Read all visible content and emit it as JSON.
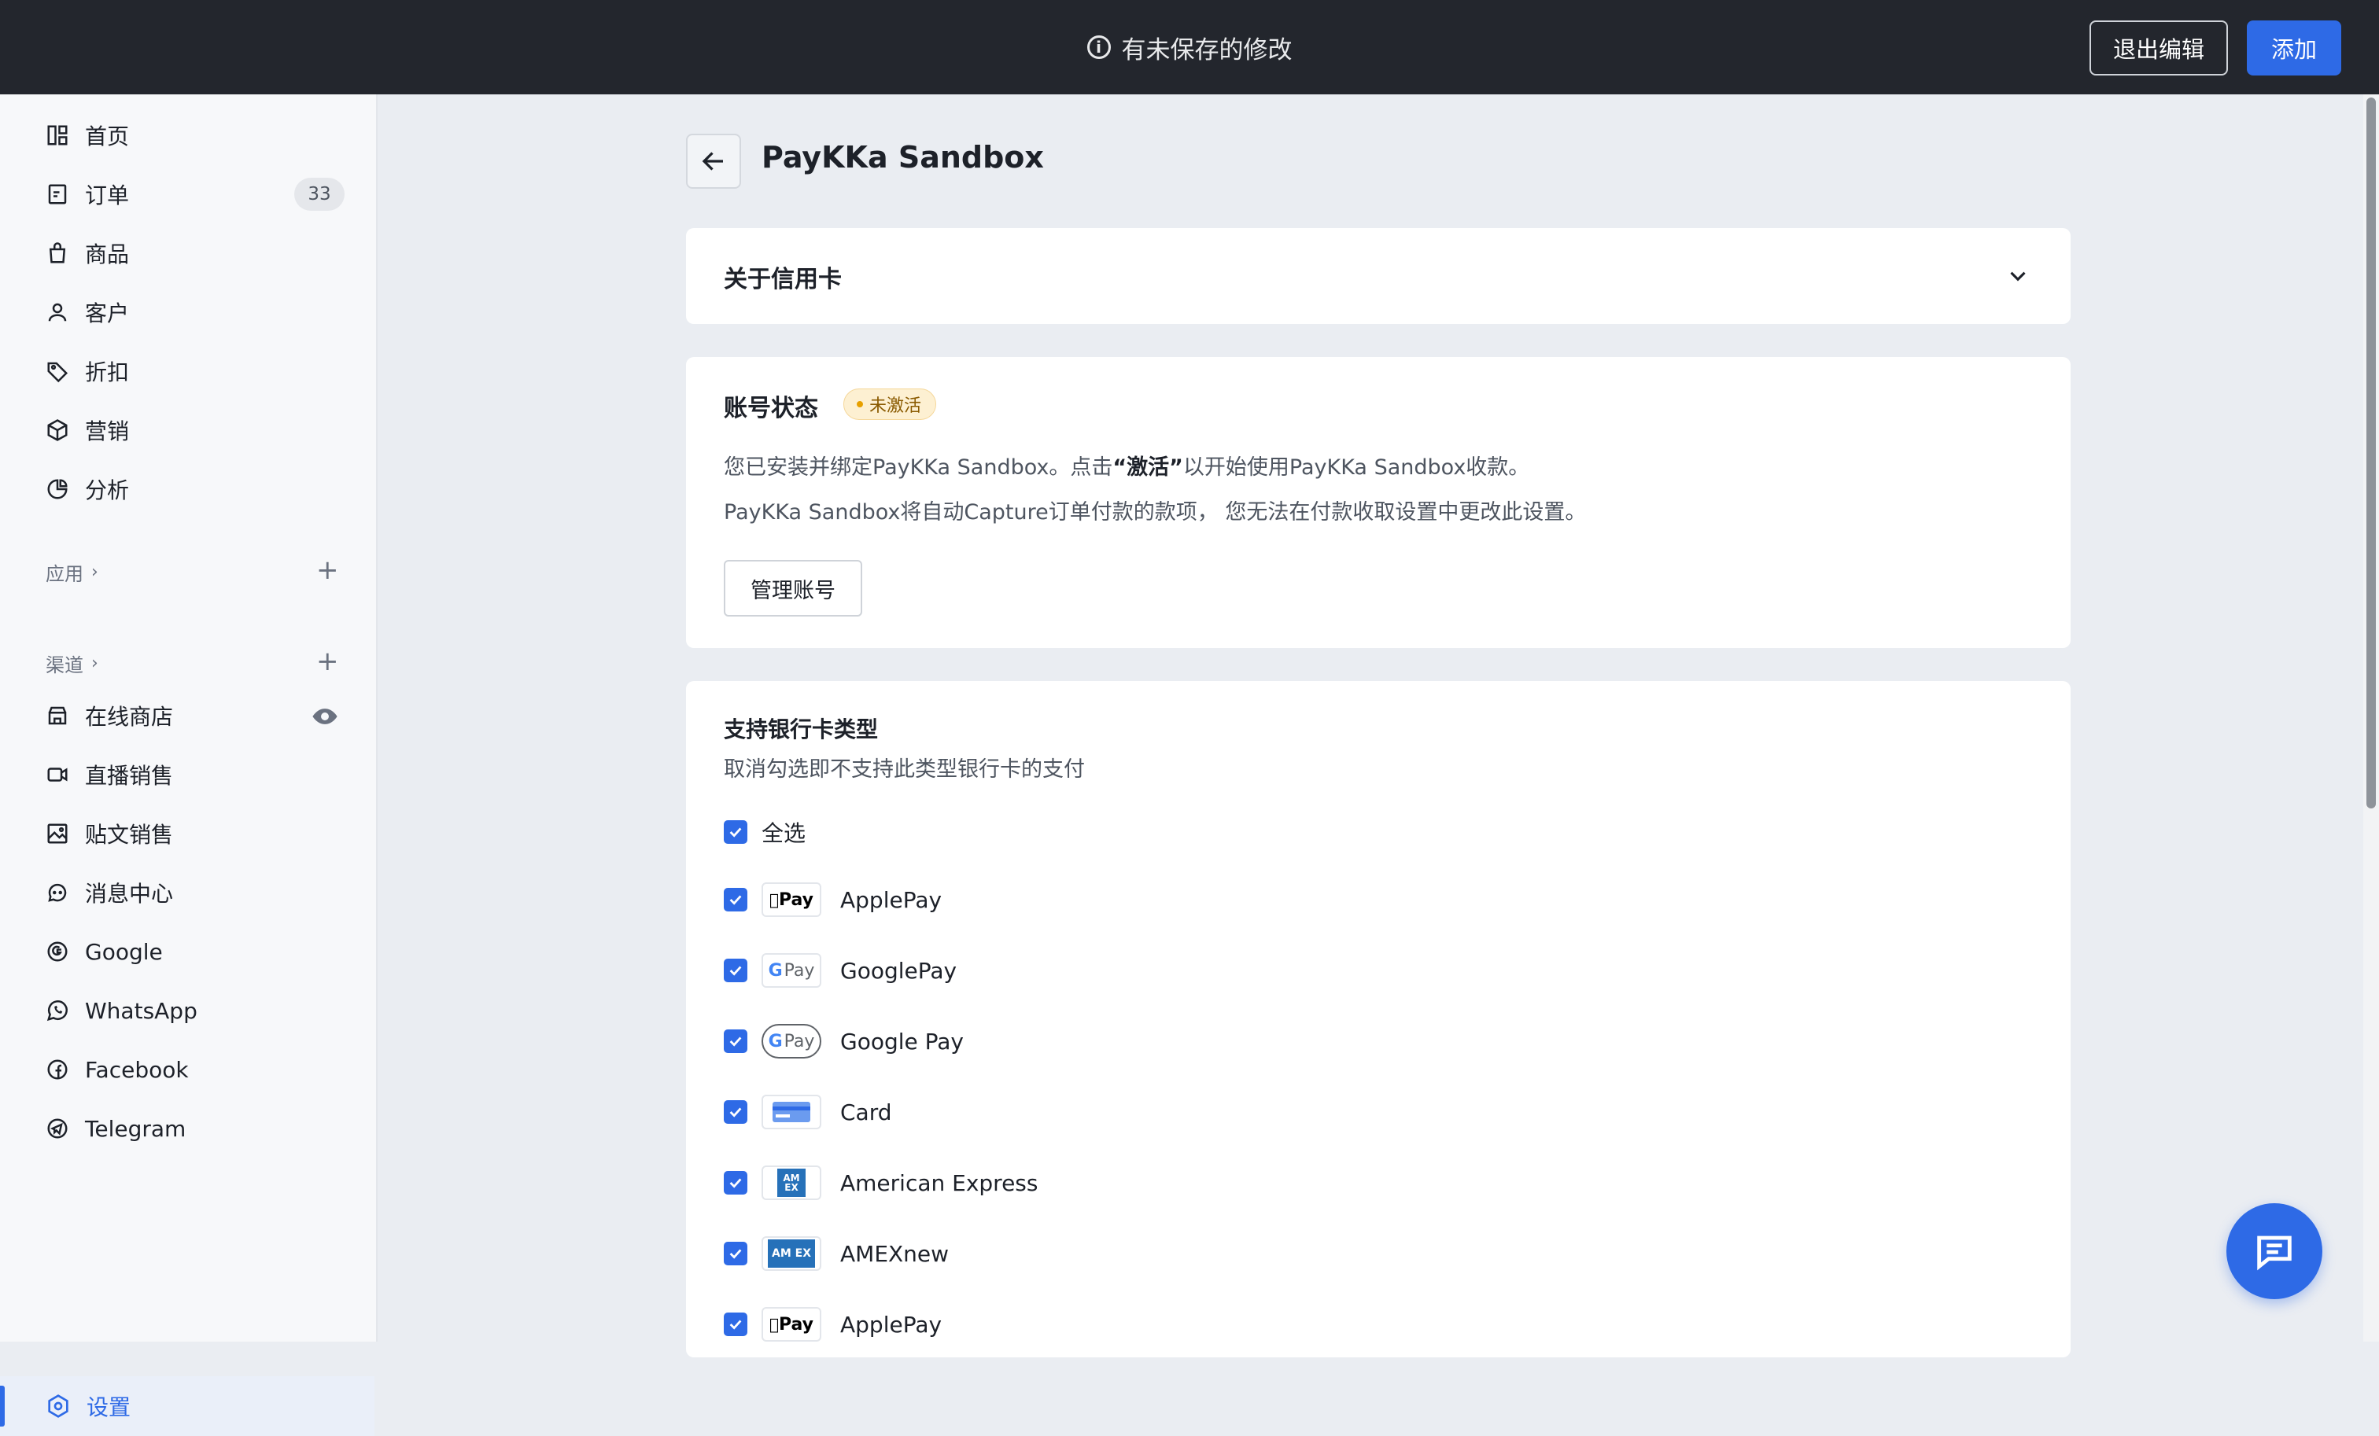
{
  "topbar": {
    "unsaved_text": "有未保存的修改",
    "exit_label": "退出编辑",
    "add_label": "添加"
  },
  "sidebar": {
    "items": [
      {
        "label": "首页",
        "icon": "dashboard-icon"
      },
      {
        "label": "订单",
        "icon": "order-icon",
        "badge": "33"
      },
      {
        "label": "商品",
        "icon": "bag-icon"
      },
      {
        "label": "客户",
        "icon": "user-icon"
      },
      {
        "label": "折扣",
        "icon": "tag-icon"
      },
      {
        "label": "营销",
        "icon": "cube-icon"
      },
      {
        "label": "分析",
        "icon": "pie-chart-icon"
      }
    ],
    "apps_title": "应用",
    "channels_title": "渠道",
    "channels": [
      {
        "label": "在线商店",
        "icon": "store-icon"
      },
      {
        "label": "直播销售",
        "icon": "video-icon"
      },
      {
        "label": "贴文销售",
        "icon": "image-icon"
      },
      {
        "label": "消息中心",
        "icon": "chat-bubble-icon"
      },
      {
        "label": "Google",
        "icon": "google-icon"
      },
      {
        "label": "WhatsApp",
        "icon": "whatsapp-icon"
      },
      {
        "label": "Facebook",
        "icon": "facebook-icon"
      },
      {
        "label": "Telegram",
        "icon": "telegram-icon"
      }
    ],
    "settings_label": "设置"
  },
  "main": {
    "title": "PayKKa Sandbox",
    "about_card": {
      "title": "关于信用卡"
    },
    "account_card": {
      "title": "账号状态",
      "status": "未激活",
      "line1_prefix": "您已安装并绑定PayKKa Sandbox。点击",
      "line1_bold": "“激活”",
      "line1_suffix": "以开始使用PayKKa Sandbox收款。",
      "line2": "PayKKa Sandbox将自动Capture订单付款的款项，  您无法在付款收取设置中更改此设置。",
      "manage_label": "管理账号"
    },
    "card_types": {
      "title": "支持银行卡类型",
      "subtitle": "取消勾选即不支持此类型银行卡的支付",
      "select_all": "全选",
      "items": [
        {
          "label": "ApplePay",
          "logo": "Pay",
          "logo_icon": "apple-pay-logo"
        },
        {
          "label": "GooglePay",
          "logo": "Pay",
          "logo_icon": "google-pay-logo"
        },
        {
          "label": "Google Pay",
          "logo": "Pay",
          "logo_icon": "google-pay-pill-logo"
        },
        {
          "label": "Card",
          "logo": "",
          "logo_icon": "card-logo"
        },
        {
          "label": "American Express",
          "logo": "AM EX",
          "logo_icon": "amex-logo"
        },
        {
          "label": "AMEXnew",
          "logo": "AM EX",
          "logo_icon": "amex-new-logo"
        },
        {
          "label": "ApplePay",
          "logo": "Pay",
          "logo_icon": "apple-pay-logo"
        }
      ]
    }
  },
  "colors": {
    "accent": "#2e6ae6",
    "topbar": "#23262d",
    "background": "#eaedf2"
  }
}
